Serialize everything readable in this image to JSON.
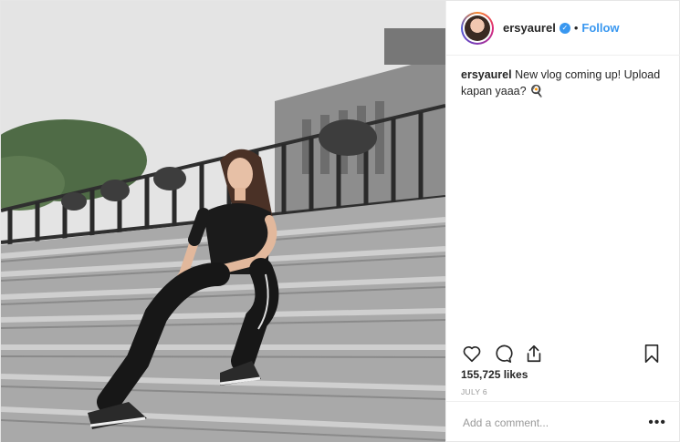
{
  "post": {
    "username": "ersyaurel",
    "follow_label": "Follow",
    "separator": "•",
    "caption_user": "ersyaurel",
    "caption_text": "New vlog coming up! Upload kapan yaaa? 🍳",
    "likes": "155,725 likes",
    "date": "JULY 6",
    "comment_placeholder": "Add a comment...",
    "more_label": "•••",
    "icons": {
      "verified": "verified-badge-icon",
      "like": "heart-icon",
      "comment": "comment-icon",
      "share": "share-icon",
      "save": "bookmark-icon"
    },
    "colors": {
      "link": "#3897f0",
      "text": "#262626",
      "muted": "#999999"
    }
  }
}
